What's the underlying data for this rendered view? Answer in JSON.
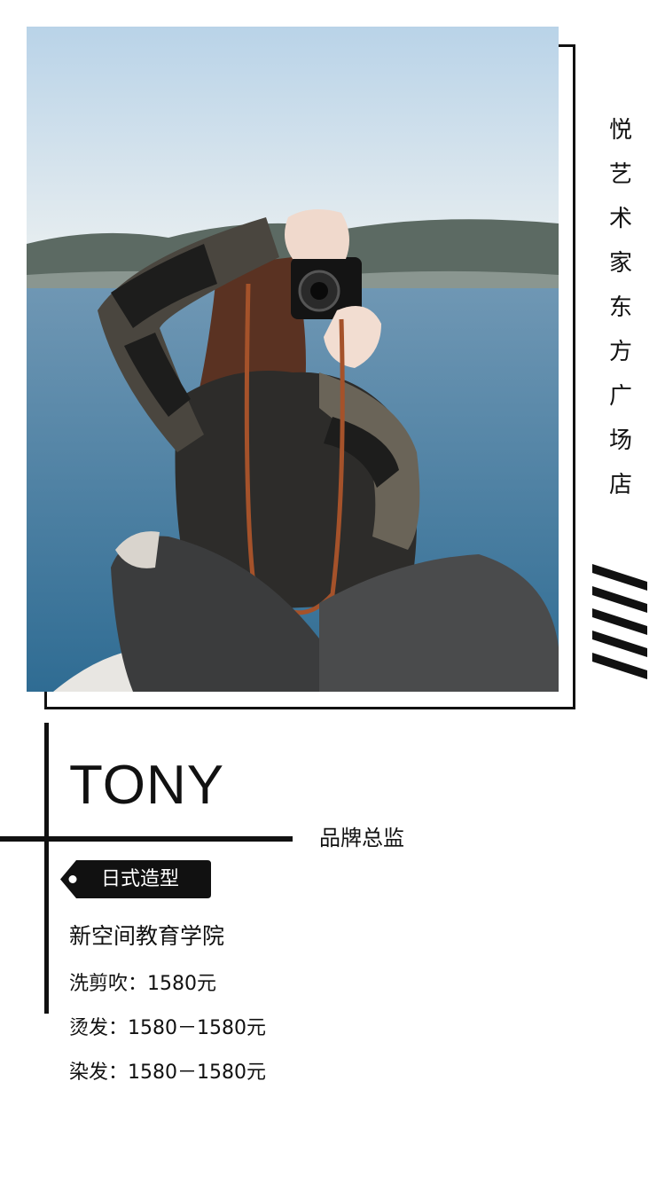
{
  "store": {
    "name_chars": [
      "悦",
      "艺",
      "术",
      "家",
      "东",
      "方",
      "广",
      "场",
      "店"
    ]
  },
  "profile": {
    "name": "TONY",
    "role": "品牌总监",
    "tag": "日式造型",
    "school": "新空间教育学院"
  },
  "prices": [
    "洗剪吹：1580元",
    "烫发：1580－1580元",
    "染发：1580－1580元"
  ],
  "colors": {
    "primary": "#111111",
    "background": "#ffffff"
  },
  "icons": {
    "tag": "price-tag-icon",
    "decoration": "diagonal-stripes-icon"
  }
}
